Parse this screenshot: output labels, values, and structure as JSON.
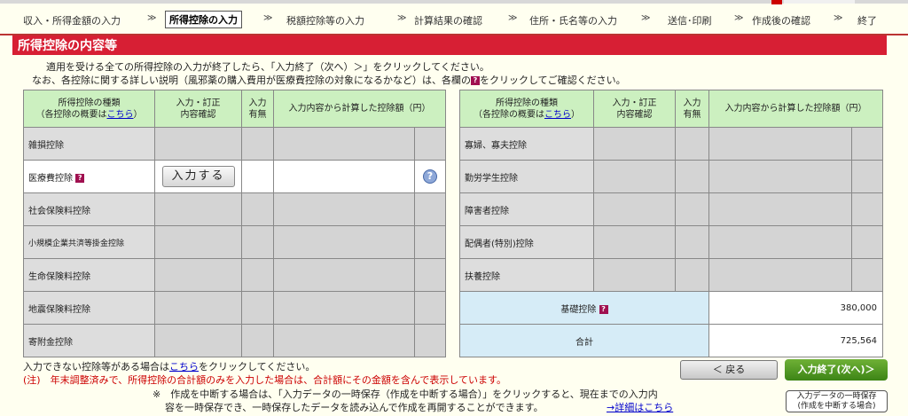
{
  "nav": {
    "steps": [
      "収入・所得金額の入力",
      "所得控除の入力",
      "税額控除等の入力",
      "計算結果の確認",
      "住所・氏名等の入力",
      "送信･印刷",
      "作成後の確認",
      "終了"
    ],
    "arrow": "≫"
  },
  "section_title": "所得控除の内容等",
  "desc": {
    "line1": "適用を受ける全ての所得控除の入力が終了したら、「入力終了（次へ）＞」をクリックしてください。",
    "line2_a": "なお、各控除に関する詳しい説明（風邪薬の購入費用が医療費控除の対象になるかなど）は、各欄の",
    "line2_b": "をクリックしてご確認ください。"
  },
  "help_mark": "?",
  "table_headers": {
    "type_line1": "所得控除の種類",
    "type_line2_a": "（各控除の概要は",
    "type_line2_link": "こちら",
    "type_line2_b": "）",
    "input_line1": "入力・訂正",
    "input_line2": "内容確認",
    "has_line1": "入力",
    "has_line2": "有無",
    "amount": "入力内容から計算した控除額（円）"
  },
  "left_rows": [
    "雑損控除",
    "医療費控除",
    "社会保険料控除",
    "小規模企業共済等掛金控除",
    "生命保険料控除",
    "地震保険料控除",
    "寄附金控除"
  ],
  "right_rows": [
    "寡婦、寡夫控除",
    "勤労学生控除",
    "障害者控除",
    "配偶者(特別)控除",
    "扶養控除"
  ],
  "input_button": "入力する",
  "basic_deduction": {
    "label": "基礎控除",
    "value": "380,000"
  },
  "total": {
    "label": "合計",
    "value": "725,564"
  },
  "footer": {
    "line1_a": "入力できない控除等がある場合は",
    "line1_link": "こちら",
    "line1_b": "をクリックしてください。",
    "note": "(注)　年末調整済みで、所得控除の合計額のみを入力した場合は、合計額にその金額を含んで表示しています。",
    "line3": "※　作成を中断する場合は、「入力データの一時保存（作成を中断する場合）」をクリックすると、現在までの入力内",
    "line4": "容を一時保存でき、一時保存したデータを読み込んで作成を再開することができます。",
    "detail_link": "→詳細はこちら"
  },
  "buttons": {
    "back": "＜ 戻る",
    "finish": "入力終了(次へ)＞",
    "save_line1": "入力データの一時保存",
    "save_line2": "(作成を中断する場合)"
  },
  "colors": {
    "title_bar": "#d71f34",
    "header_bg": "#ccf0c0",
    "total_bg": "#d6ecf7",
    "finish_btn": "#4e9a22"
  }
}
